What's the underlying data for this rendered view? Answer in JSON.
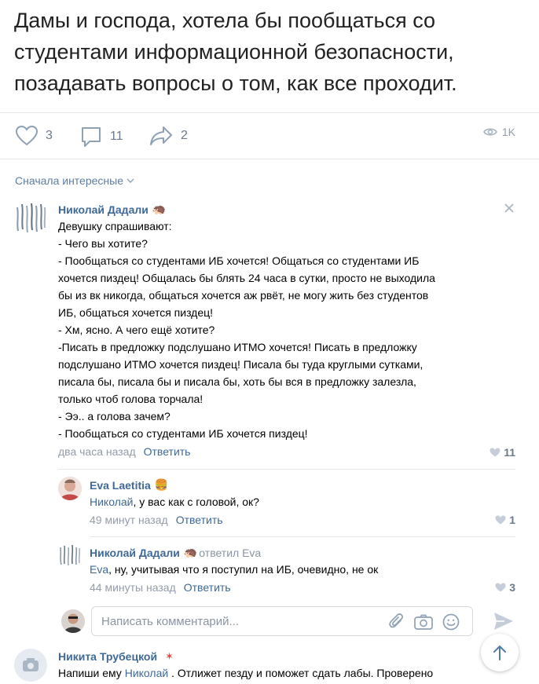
{
  "post": {
    "text": "Дамы и господа, хотела бы пообщаться со студентами информационной безопасности, позадавать вопросы о том, как все проходит."
  },
  "actions": {
    "likes": "3",
    "comments": "11",
    "shares": "2",
    "views": "1K"
  },
  "sort": {
    "label": "Сначала интересные"
  },
  "comments": [
    {
      "author": "Николай Дадали",
      "emoji": "🦔",
      "lines": [
        "Девушку спрашивают:",
        "- Чего вы хотите?",
        "- Пообщаться со студентами ИБ хочется! Общаться со студентами ИБ",
        "хочется пиздец! Общалась бы блять 24 часа в сутки, просто не выходила",
        "бы из вк никогда, общаться хочется аж рвёт, не могу жить без студентов",
        "ИБ, общаться хочется пиздец!",
        "- Хм, ясно. А чего ещё хотите?",
        "-Писать в предложку подслушано ИТМО хочется! Писать в предложку",
        "подслушано ИТМО хочется пиздец! Писала бы туда круглыми сутками,",
        "писала бы, писала бы и писала бы, хоть бы вся в предложку залезла,",
        "только чтоб голова торчала!",
        "- Ээ.. а голова зачем?",
        "- Пообщаться со студентами ИБ хочется пиздец!"
      ],
      "time": "два часа назад",
      "reply_label": "Ответить",
      "likes": "11"
    }
  ],
  "replies": [
    {
      "author": "Eva Laetitia",
      "emoji": "🍔",
      "mention": "Николай",
      "text": ", у вас как с головой, ок?",
      "time": "49 минут назад",
      "reply_label": "Ответить",
      "likes": "1"
    },
    {
      "author": "Николай Дадали",
      "emoji": "🦔",
      "replied_to": "ответил Eva",
      "mention": "Eva",
      "text": ", ну, учитывая что я поступил на ИБ, очевидно, не ок",
      "time": "44 минуты назад",
      "reply_label": "Ответить",
      "likes": "3"
    }
  ],
  "composer": {
    "placeholder": "Написать комментарий..."
  },
  "last_comment": {
    "author": "Никита Трубецкой",
    "badge": "✶",
    "text_before": "Напиши ему ",
    "mention": "Николай",
    "text_after": " . Отлижет пезду и поможет сдать лабы. Проверено"
  }
}
